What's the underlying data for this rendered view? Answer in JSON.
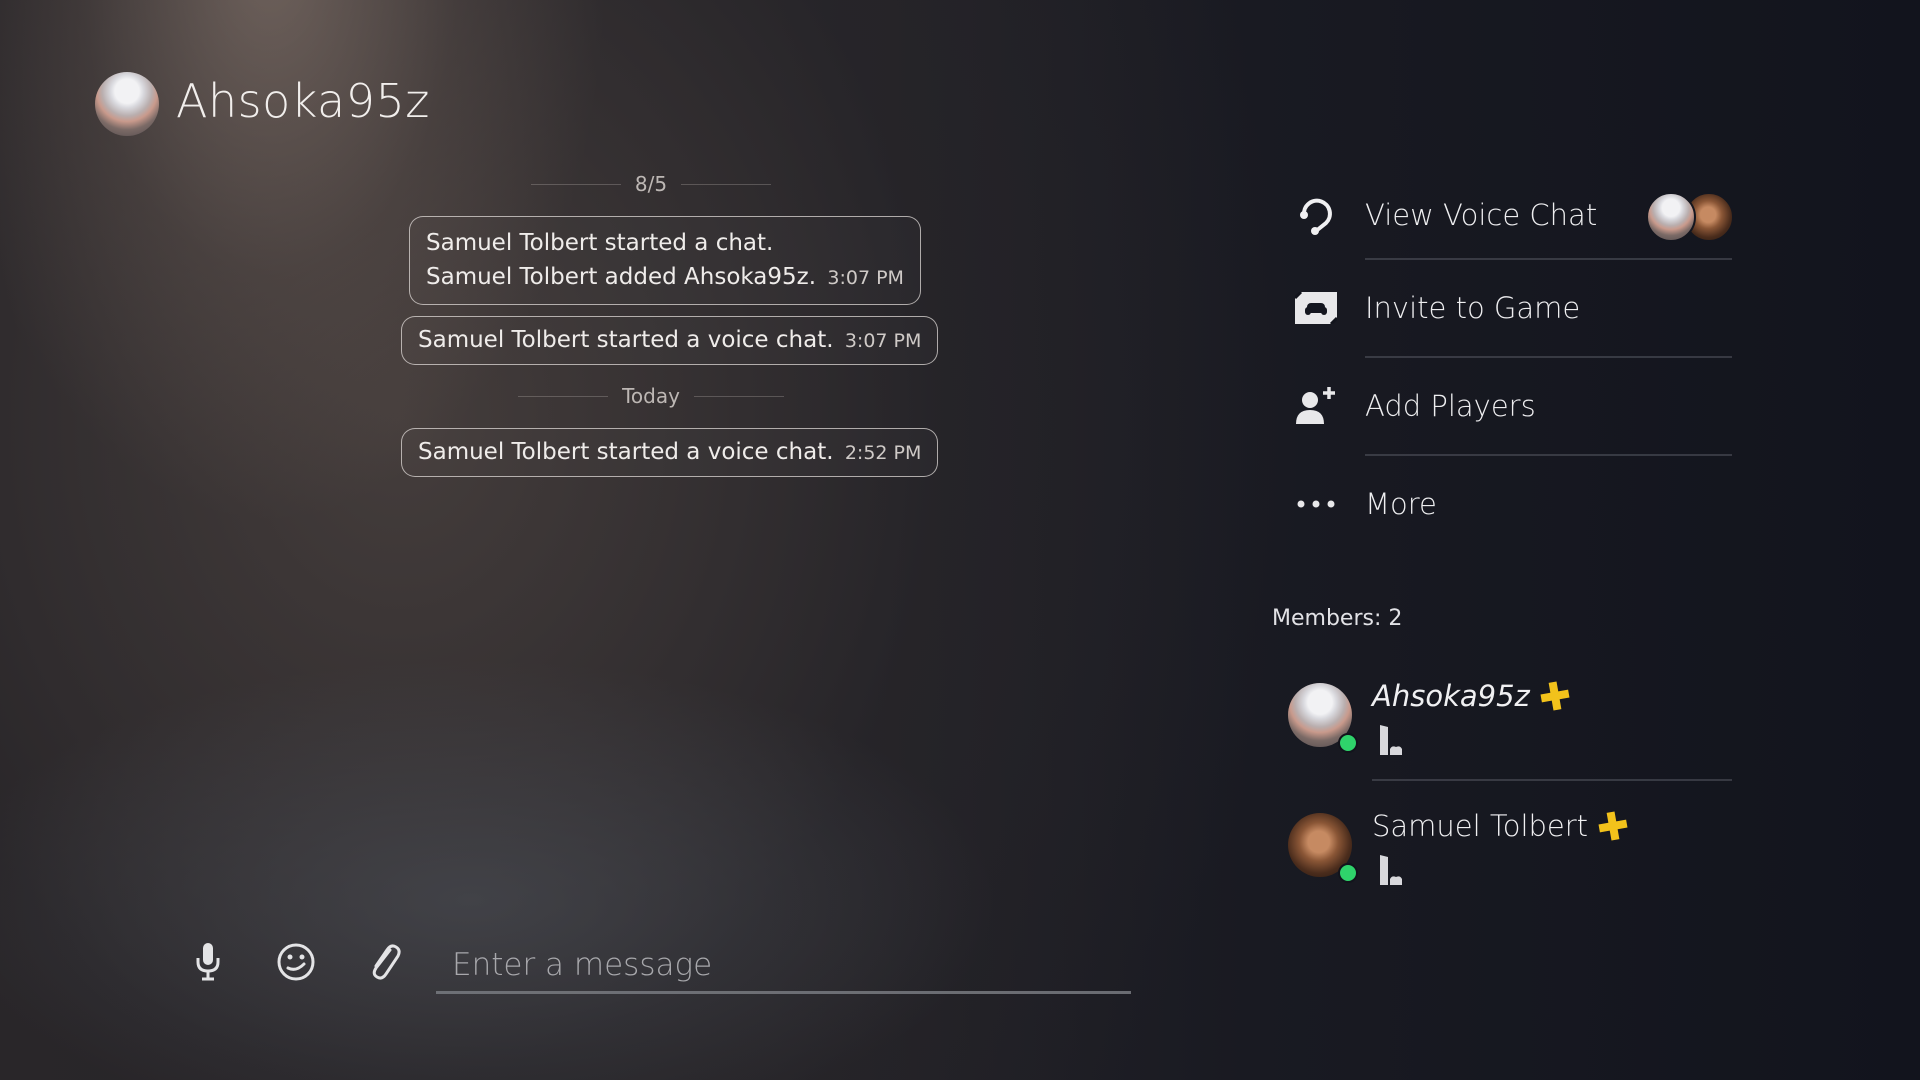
{
  "header": {
    "title": "Ahsoka95z",
    "avatar": "user-avatar-ahsoka95z"
  },
  "chat": {
    "date_separators": [
      "8/5",
      "Today"
    ],
    "messages": [
      {
        "lines": [
          "Samuel Tolbert started a chat.",
          "Samuel Tolbert added Ahsoka95z."
        ],
        "time": "3:07 PM"
      },
      {
        "lines": [
          "Samuel Tolbert started a voice chat."
        ],
        "time": "3:07 PM"
      },
      {
        "lines": [
          "Samuel Tolbert started a voice chat."
        ],
        "time": "2:52 PM"
      }
    ]
  },
  "actions": [
    {
      "label": "View Voice Chat",
      "icon": "headset-icon"
    },
    {
      "label": "Invite to Game",
      "icon": "invite-game-icon"
    },
    {
      "label": "Add Players",
      "icon": "add-player-icon"
    },
    {
      "label": "More",
      "icon": "more-dots-icon"
    }
  ],
  "members": {
    "label": "Members: 2",
    "list": [
      {
        "name": "Ahsoka95z",
        "status": "online",
        "ps_plus": true,
        "platform": "PS5"
      },
      {
        "name": "Samuel Tolbert",
        "status": "online",
        "ps_plus": true,
        "platform": "PS5"
      }
    ]
  },
  "composer": {
    "placeholder": "Enter a message",
    "value": "",
    "tools": [
      "microphone-icon",
      "emoji-icon",
      "attachment-icon"
    ]
  },
  "colors": {
    "online": "#2fd36b",
    "ps_plus": "#f2c21b"
  }
}
